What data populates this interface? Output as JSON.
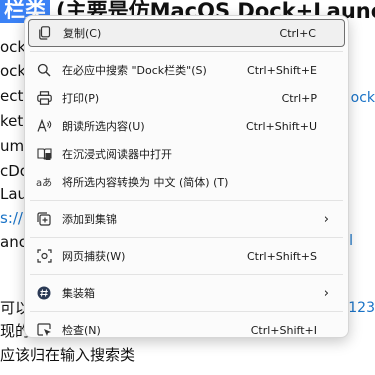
{
  "background": {
    "heading_tag": "栏类",
    "heading_text": "(主要是仿MacOS Dock+LaunchP",
    "lines": [
      "ock",
      "ock",
      "ectD",
      "ketD",
      "ume",
      "cDo",
      "Laun",
      "s://",
      "anch"
    ],
    "right_texts": [
      "ock",
      "l"
    ],
    "bottom_left_1": "可以",
    "bottom_left_2": "现的",
    "bottom_right": "123",
    "bottom_line": "应该归在输入搜索类"
  },
  "menu": {
    "items": [
      {
        "label": "复制(C)",
        "shortcut": "Ctrl+C",
        "icon": "copy-icon"
      },
      {
        "label": "在必应中搜索 \"Dock栏类\"(S)",
        "shortcut": "Ctrl+Shift+E",
        "icon": "search-icon"
      },
      {
        "label": "打印(P)",
        "shortcut": "Ctrl+P",
        "icon": "print-icon"
      },
      {
        "label": "朗读所选内容(U)",
        "shortcut": "Ctrl+Shift+U",
        "icon": "read-aloud-icon"
      },
      {
        "label": "在沉浸式阅读器中打开",
        "shortcut": "",
        "icon": "immersive-reader-icon"
      },
      {
        "label": "将所选内容转换为 中文 (简体) (T)",
        "shortcut": "",
        "icon": "translate-icon"
      },
      {
        "label": "添加到集锦",
        "shortcut": "",
        "icon": "collections-icon"
      },
      {
        "label": "网页捕获(W)",
        "shortcut": "Ctrl+Shift+S",
        "icon": "web-capture-icon"
      },
      {
        "label": "集装箱",
        "shortcut": "",
        "icon": "hash-icon"
      },
      {
        "label": "检查(N)",
        "shortcut": "Ctrl+Shift+I",
        "icon": "inspect-icon"
      }
    ]
  },
  "colors": {
    "tag_bg": "#3b82f6",
    "link": "#1a73c7",
    "menu_bg": "#fbfbfb"
  }
}
